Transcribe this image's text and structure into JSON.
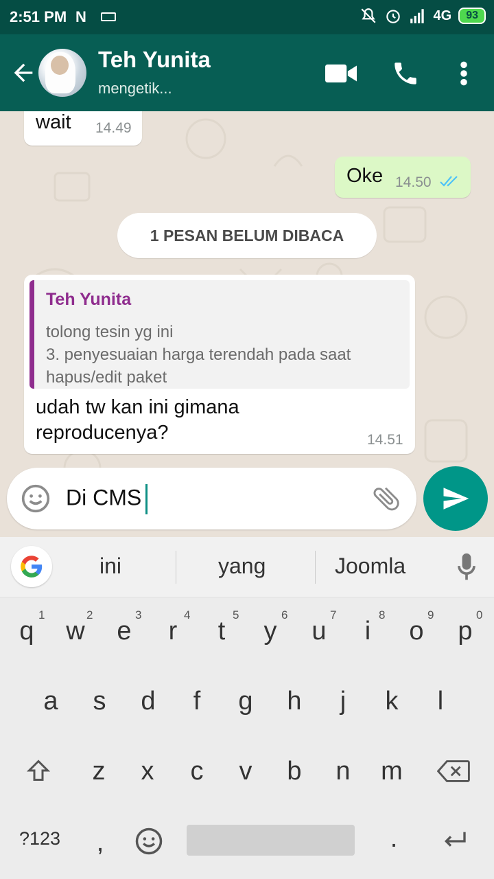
{
  "status_bar": {
    "time": "2:51 PM",
    "notif_glyph": "N",
    "network": "4G",
    "battery": "93"
  },
  "header": {
    "contact_name": "Teh Yunita",
    "contact_status": "mengetik..."
  },
  "messages": [
    {
      "direction": "in",
      "text": "wait",
      "time": "14.49"
    },
    {
      "direction": "out",
      "text": "Oke",
      "time": "14.50"
    }
  ],
  "unread_banner": "1 PESAN BELUM DIBACA",
  "reply_message": {
    "quote_author": "Teh Yunita",
    "quote_lines": [
      "tolong tesin yg ini",
      "3. penyesuaian harga terendah pada saat",
      "hapus/edit paket"
    ],
    "text_lines": [
      "udah tw kan ini gimana",
      "reproducenya?"
    ],
    "time": "14.51"
  },
  "composer": {
    "text": "Di CMS"
  },
  "keyboard": {
    "suggestions": [
      "ini",
      "yang",
      "Joomla"
    ],
    "row1": [
      "q",
      "w",
      "e",
      "r",
      "t",
      "y",
      "u",
      "i",
      "o",
      "p"
    ],
    "row1_hints": [
      "1",
      "2",
      "3",
      "4",
      "5",
      "6",
      "7",
      "8",
      "9",
      "0"
    ],
    "row2": [
      "a",
      "s",
      "d",
      "f",
      "g",
      "h",
      "j",
      "k",
      "l"
    ],
    "row3": [
      "z",
      "x",
      "c",
      "v",
      "b",
      "n",
      "m"
    ],
    "symbols_key": "?123",
    "comma_key": ",",
    "period_key": "."
  },
  "colors": {
    "header": "#075e54",
    "statusbar": "#054d44",
    "outgoing": "#dcf8c6",
    "send": "#009688",
    "quote_accent": "#8f2d8e"
  }
}
